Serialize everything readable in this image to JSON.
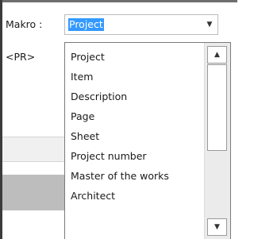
{
  "form": {
    "makro_label": "Makro :",
    "pr_label": "<PR>"
  },
  "combo": {
    "selected_value": "Project",
    "arrow_icon": "▼"
  },
  "dropdown": {
    "items": [
      "Project",
      "Item",
      "Description",
      "Page",
      "Sheet",
      "Project number",
      "Master of the works",
      "Architect"
    ],
    "scroll_up_icon": "▲",
    "scroll_down_icon": "▼"
  },
  "colors": {
    "selection": "#3399ff",
    "frame": "#3b3b3b"
  }
}
